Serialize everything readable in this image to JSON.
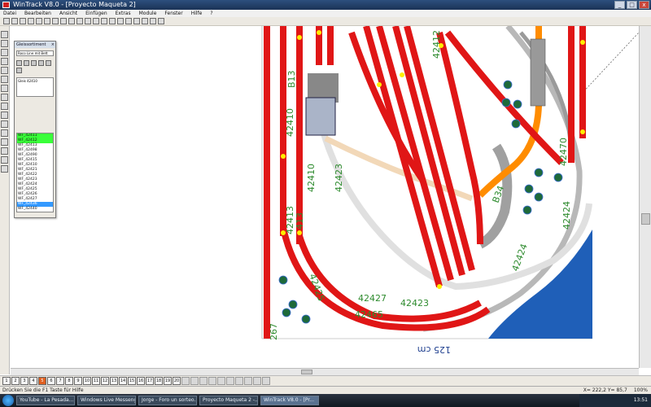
{
  "window": {
    "title": "WinTrack V8.0 - [Proyecto Maqueta 2]",
    "buttons": [
      "_",
      "□",
      "x"
    ]
  },
  "menu": [
    "Datei",
    "Bearbeiten",
    "Ansicht",
    "Einfügen",
    "Extras",
    "Module",
    "Fenster",
    "Hilfe",
    "?"
  ],
  "toolbar_icons": [
    "new-icon",
    "open-icon",
    "save-icon",
    "print-icon",
    "zoom-in-icon",
    "zoom-out-icon",
    "select-icon",
    "rotate-icon",
    "mirror-icon",
    "move-icon",
    "undo-icon",
    "redo-icon",
    "cut-icon",
    "copy-icon",
    "paste-icon",
    "delete-icon",
    "grid-icon",
    "layer-icon",
    "measure-icon",
    "help-icon"
  ],
  "track_panel": {
    "title": "Gleissortiment",
    "system": "Roco Line mit Bett",
    "preview_label": "Gleis 42410",
    "items": [
      "WF_42411",
      "WF_42412",
      "WF_42413",
      "WF_42498",
      "WF_42490",
      "WF_42415",
      "WF_42410",
      "WF_42421",
      "WF_42422",
      "WF_42423",
      "WF_42424",
      "WF_42425",
      "WF_42426",
      "WF_42427",
      "WF_42436",
      "WF_42440"
    ]
  },
  "layout_labels": {
    "scale_label": "125 cm",
    "track_numbers": [
      "42410",
      "42412",
      "42413",
      "42423",
      "42424",
      "42425",
      "42427",
      "42465",
      "42470",
      "42410",
      "42423",
      "42424",
      "267"
    ],
    "platform_labels": [
      "B13",
      "B34",
      "413"
    ]
  },
  "layers": [
    "1",
    "2",
    "3",
    "4",
    "5",
    "6",
    "7",
    "8",
    "9",
    "10",
    "11",
    "12",
    "13",
    "14",
    "15",
    "16",
    "17",
    "18",
    "19",
    "20"
  ],
  "active_layer": "5",
  "status": {
    "left": "Drücken Sie die F1 Taste für Hilfe",
    "coords": "X=  222,2  Y=  85,7",
    "zoom": "100%"
  },
  "taskbar": {
    "items": [
      "YouTube - La Pesada...",
      "Windows Live Messeng...",
      "Jorge - Foro un sorteo...",
      "Proyecto Maqueta 2 -...",
      "WinTrack V8.0 - [Pr..."
    ],
    "active_index": 4,
    "clock": "13:51"
  },
  "colors": {
    "track": "#e01616",
    "grey_track": "#b8b8b8",
    "orange_track": "#ff8c00",
    "water": "#1f5fb8",
    "label": "#2e8b2e"
  }
}
